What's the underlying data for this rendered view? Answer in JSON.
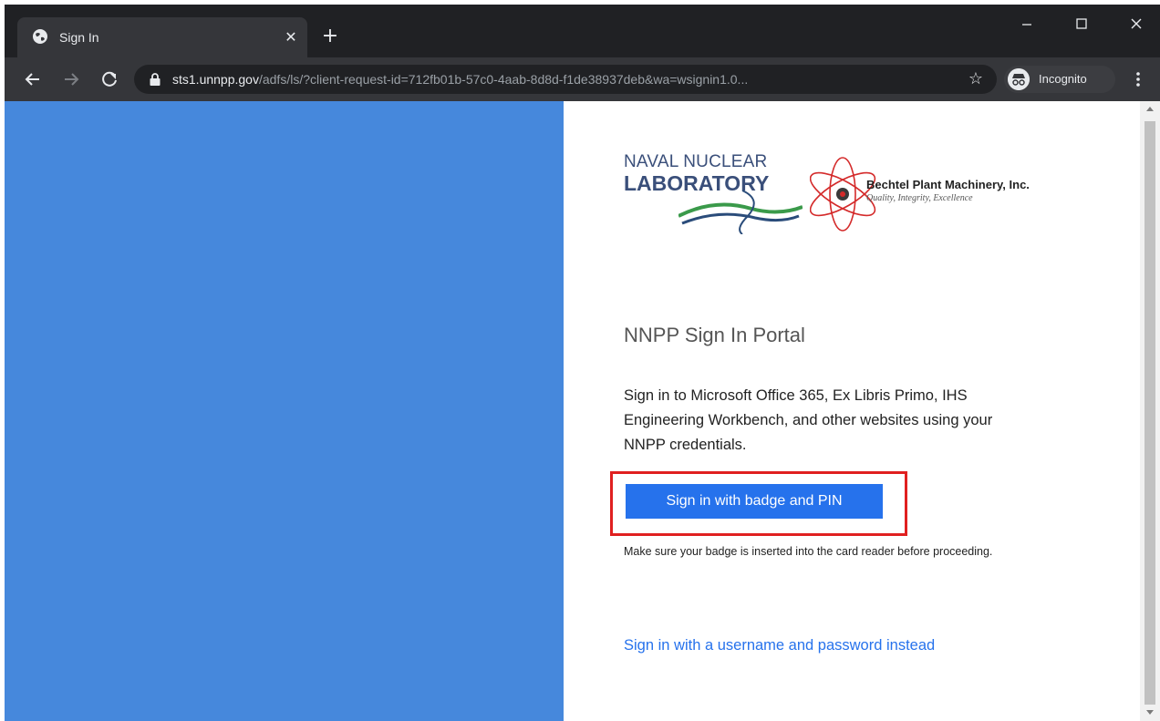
{
  "browser": {
    "tab": {
      "title": "Sign In"
    },
    "omnibox": {
      "host": "sts1.unnpp.gov",
      "path": "/adfs/ls/?client-request-id=712fb01b-57c0-4aab-8d8d-f1de38937deb&wa=wsignin1.0..."
    },
    "profile": {
      "label": "Incognito"
    },
    "icons": [
      "globe-icon",
      "close-icon",
      "plus-icon",
      "minimize-icon",
      "maximize-icon",
      "close-window-icon",
      "back-arrow-icon",
      "forward-arrow-icon",
      "reload-icon",
      "lock-icon",
      "star-icon",
      "incognito-icon",
      "kebab-menu-icon"
    ]
  },
  "page": {
    "logos": {
      "nnl": {
        "line1": "NAVAL NUCLEAR",
        "line2": "LABORATORY"
      },
      "bpmi": {
        "name": "Bechtel Plant Machinery, Inc.",
        "tagline": "Quality, Integrity, Excellence"
      }
    },
    "title": "NNPP Sign In Portal",
    "intro": "Sign in to Microsoft Office 365, Ex Libris Primo, IHS Engineering Workbench, and other websites using your NNPP credentials.",
    "primary_button": "Sign in with badge and PIN",
    "note": "Make sure your badge is inserted into the card reader before proceeding.",
    "alt_link": "Sign in with a username and password instead"
  },
  "colors": {
    "left_panel": "#4688dc",
    "button": "#2672ec",
    "highlight": "#e02020",
    "chrome_dark": "#202124",
    "chrome_toolbar": "#35363a"
  }
}
